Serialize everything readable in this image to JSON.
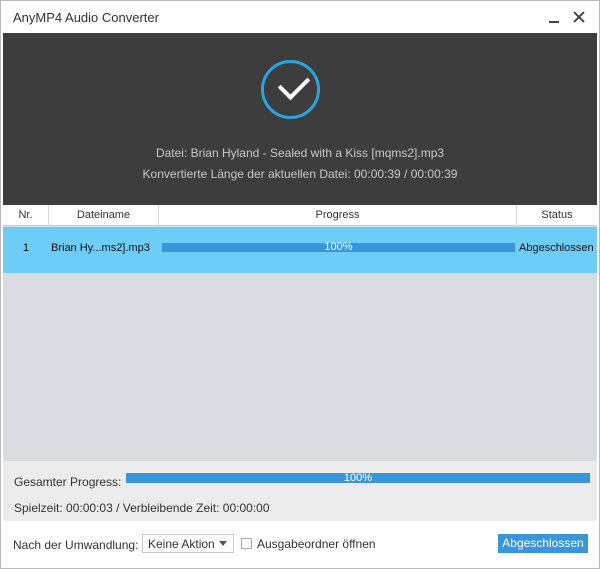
{
  "window": {
    "title": "AnyMP4 Audio Converter"
  },
  "header": {
    "file_line": "Datei: Brian Hyland - Sealed with a Kiss [mqms2].mp3",
    "length_line": "Konvertierte Länge der aktuellen Datei: 00:00:39 / 00:00:39"
  },
  "table": {
    "columns": [
      "Nr.",
      "Dateiname",
      "Progress",
      "Status"
    ],
    "rows": [
      {
        "nr": "1",
        "name": "Brian Hy...ms2].mp3",
        "progress_text": "100%",
        "progress_value": 1.0,
        "status": "Abgeschlossen"
      }
    ]
  },
  "footer": {
    "total_label": "Gesamter Progress:",
    "total_text": "100%",
    "total_value": 1.0,
    "time_line": "Spielzeit: 00:00:03 / Verbleibende Zeit: 00:00:00"
  },
  "bottom": {
    "after_label": "Nach der Umwandlung:",
    "after_select": "Keine Aktion",
    "open_folder_label": "Ausgabeordner öffnen",
    "open_folder_checked": false,
    "done_button": "Abgeschlossen"
  },
  "colors": {
    "accent": "#3a96dc",
    "header_bg": "#3d3d3d",
    "row_selected": "#6ecdf7",
    "check_ring": "#2aa5e2"
  }
}
